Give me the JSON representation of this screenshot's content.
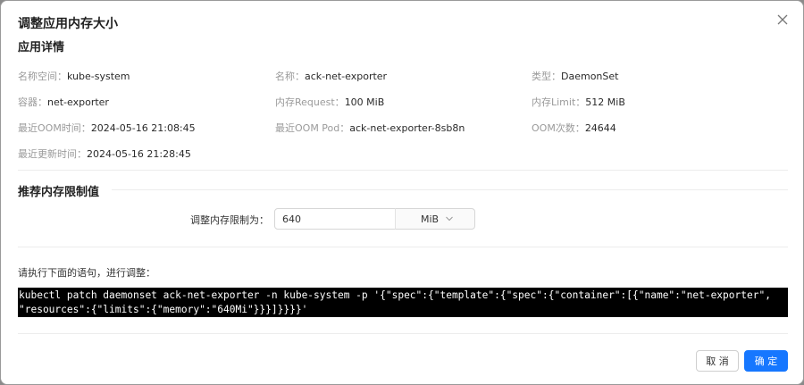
{
  "dialog": {
    "title": "调整应用内存大小",
    "close_icon": "close-icon"
  },
  "details": {
    "heading": "应用详情",
    "items": [
      {
        "key": "名称空间：",
        "value": "kube-system"
      },
      {
        "key": "名称：",
        "value": "ack-net-exporter"
      },
      {
        "key": "类型：",
        "value": "DaemonSet"
      },
      {
        "key": "容器：",
        "value": "net-exporter"
      },
      {
        "key": "内存Request：",
        "value": "100 MiB"
      },
      {
        "key": "内存Limit：",
        "value": "512 MiB"
      },
      {
        "key": "最近OOM时间：",
        "value": "2024-05-16 21:08:45"
      },
      {
        "key": "最近OOM Pod：",
        "value": "ack-net-exporter-8sb8n"
      },
      {
        "key": "OOM次数：",
        "value": "24644"
      },
      {
        "key": "最近更新时间：",
        "value": "2024-05-16 21:28:45"
      }
    ]
  },
  "recommend": {
    "heading": "推荐内存限制值",
    "label": "调整内存限制为：",
    "value": "640",
    "unit": "MiB",
    "unit_icon": "chevron-down-icon"
  },
  "command": {
    "label": "请执行下面的语句，进行调整：",
    "line1": "kubectl patch daemonset ack-net-exporter -n kube-system -p '{\"spec\":{\"template\":{\"spec\":{\"container\":[{\"name\":\"net-exporter\",",
    "line2": "\"resources\":{\"limits\":{\"memory\":\"640Mi\"}}}]}}}}'"
  },
  "footer": {
    "cancel": "取 消",
    "ok": "确 定"
  },
  "colors": {
    "primary": "#1677ff",
    "code_bg": "#000000",
    "label_gray": "#9a9a9a"
  }
}
